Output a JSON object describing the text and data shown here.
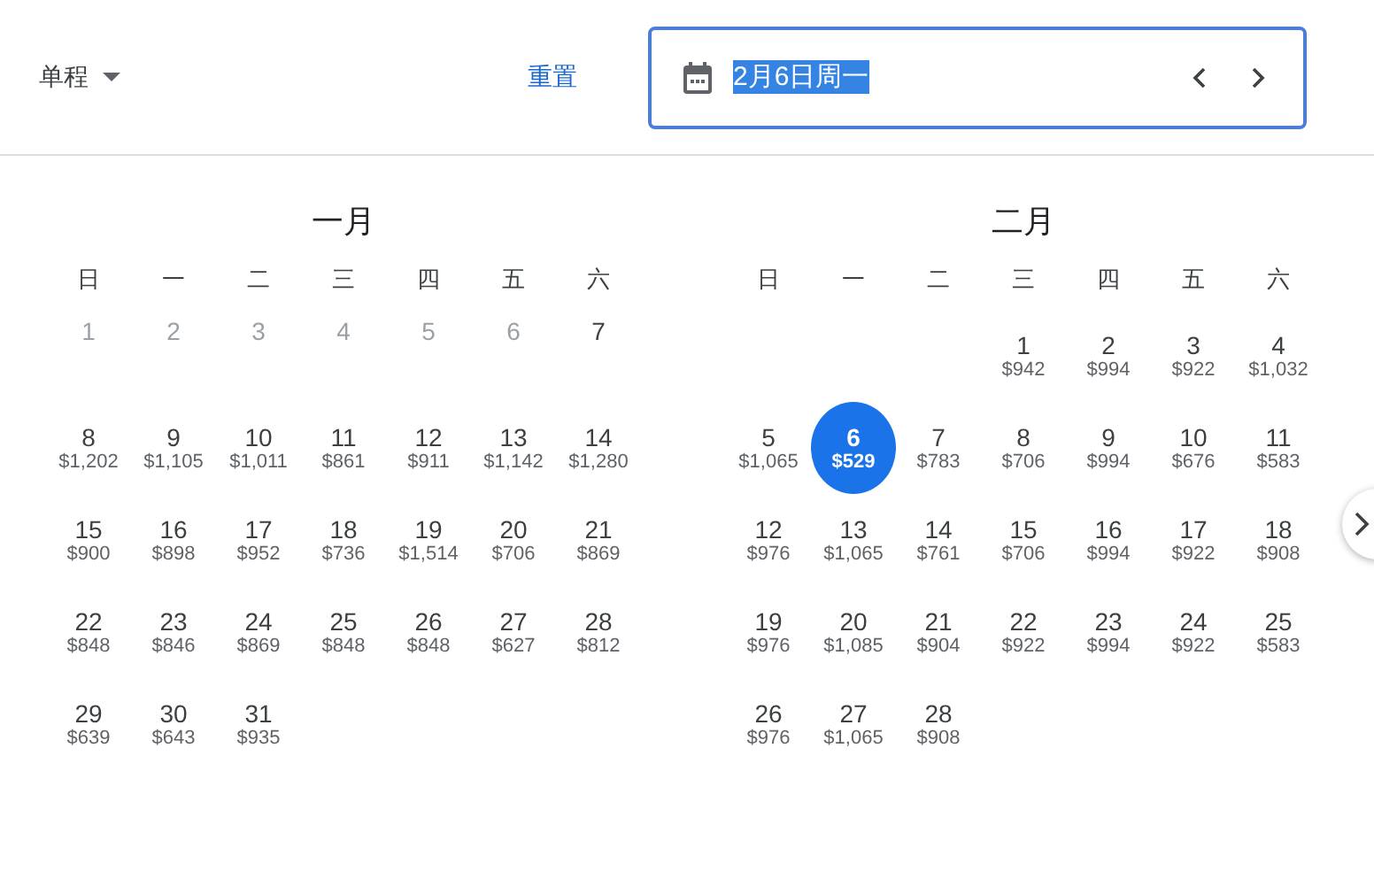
{
  "trip_type": {
    "label": "单程"
  },
  "reset_link": "重置",
  "date_field": {
    "value": "2月6日周一",
    "value_highlighted": true
  },
  "months": [
    {
      "title": "一月",
      "weekdays": [
        "日",
        "一",
        "二",
        "三",
        "四",
        "五",
        "六"
      ],
      "weeks": [
        {
          "sun": {
            "day": "1",
            "disabled": true,
            "selected": false
          },
          "mon": {
            "day": "2",
            "disabled": true,
            "selected": false
          },
          "tue": {
            "day": "3",
            "disabled": true,
            "selected": false
          },
          "wed": {
            "day": "4",
            "disabled": true,
            "selected": false
          },
          "thu": {
            "day": "5",
            "disabled": true,
            "selected": false
          },
          "fri": {
            "day": "6",
            "disabled": true,
            "selected": false
          },
          "sat": {
            "day": "7",
            "disabled": false,
            "selected": false
          }
        },
        {
          "sun": {
            "day": "8",
            "price": "$1,202",
            "disabled": false,
            "selected": false
          },
          "mon": {
            "day": "9",
            "price": "$1,105",
            "disabled": false,
            "selected": false
          },
          "tue": {
            "day": "10",
            "price": "$1,011",
            "disabled": false,
            "selected": false
          },
          "wed": {
            "day": "11",
            "price": "$861",
            "disabled": false,
            "selected": false
          },
          "thu": {
            "day": "12",
            "price": "$911",
            "disabled": false,
            "selected": false
          },
          "fri": {
            "day": "13",
            "price": "$1,142",
            "disabled": false,
            "selected": false
          },
          "sat": {
            "day": "14",
            "price": "$1,280",
            "disabled": false,
            "selected": false
          }
        },
        {
          "sun": {
            "day": "15",
            "price": "$900",
            "disabled": false,
            "selected": false
          },
          "mon": {
            "day": "16",
            "price": "$898",
            "disabled": false,
            "selected": false
          },
          "tue": {
            "day": "17",
            "price": "$952",
            "disabled": false,
            "selected": false
          },
          "wed": {
            "day": "18",
            "price": "$736",
            "disabled": false,
            "selected": false
          },
          "thu": {
            "day": "19",
            "price": "$1,514",
            "disabled": false,
            "selected": false
          },
          "fri": {
            "day": "20",
            "price": "$706",
            "disabled": false,
            "selected": false
          },
          "sat": {
            "day": "21",
            "price": "$869",
            "disabled": false,
            "selected": false
          }
        },
        {
          "sun": {
            "day": "22",
            "price": "$848",
            "disabled": false,
            "selected": false
          },
          "mon": {
            "day": "23",
            "price": "$846",
            "disabled": false,
            "selected": false
          },
          "tue": {
            "day": "24",
            "price": "$869",
            "disabled": false,
            "selected": false
          },
          "wed": {
            "day": "25",
            "price": "$848",
            "disabled": false,
            "selected": false
          },
          "thu": {
            "day": "26",
            "price": "$848",
            "disabled": false,
            "selected": false
          },
          "fri": {
            "day": "27",
            "price": "$627",
            "disabled": false,
            "selected": false
          },
          "sat": {
            "day": "28",
            "price": "$812",
            "disabled": false,
            "selected": false
          }
        },
        {
          "sun": {
            "day": "29",
            "price": "$639",
            "disabled": false,
            "selected": false
          },
          "mon": {
            "day": "30",
            "price": "$643",
            "disabled": false,
            "selected": false
          },
          "tue": {
            "day": "31",
            "price": "$935",
            "disabled": false,
            "selected": false
          }
        }
      ]
    },
    {
      "title": "二月",
      "weekdays": [
        "日",
        "一",
        "二",
        "三",
        "四",
        "五",
        "六"
      ],
      "weeks": [
        {
          "wed": {
            "day": "1",
            "price": "$942",
            "disabled": false,
            "selected": false
          },
          "thu": {
            "day": "2",
            "price": "$994",
            "disabled": false,
            "selected": false
          },
          "fri": {
            "day": "3",
            "price": "$922",
            "disabled": false,
            "selected": false
          },
          "sat": {
            "day": "4",
            "price": "$1,032",
            "disabled": false,
            "selected": false
          }
        },
        {
          "sun": {
            "day": "5",
            "price": "$1,065",
            "disabled": false,
            "selected": false
          },
          "mon": {
            "day": "6",
            "price": "$529",
            "disabled": false,
            "selected": true
          },
          "tue": {
            "day": "7",
            "price": "$783",
            "disabled": false,
            "selected": false
          },
          "wed": {
            "day": "8",
            "price": "$706",
            "disabled": false,
            "selected": false
          },
          "thu": {
            "day": "9",
            "price": "$994",
            "disabled": false,
            "selected": false
          },
          "fri": {
            "day": "10",
            "price": "$676",
            "disabled": false,
            "selected": false
          },
          "sat": {
            "day": "11",
            "price": "$583",
            "disabled": false,
            "selected": false
          }
        },
        {
          "sun": {
            "day": "12",
            "price": "$976",
            "disabled": false,
            "selected": false
          },
          "mon": {
            "day": "13",
            "price": "$1,065",
            "disabled": false,
            "selected": false
          },
          "tue": {
            "day": "14",
            "price": "$761",
            "disabled": false,
            "selected": false
          },
          "wed": {
            "day": "15",
            "price": "$706",
            "disabled": false,
            "selected": false
          },
          "thu": {
            "day": "16",
            "price": "$994",
            "disabled": false,
            "selected": false
          },
          "fri": {
            "day": "17",
            "price": "$922",
            "disabled": false,
            "selected": false
          },
          "sat": {
            "day": "18",
            "price": "$908",
            "disabled": false,
            "selected": false
          }
        },
        {
          "sun": {
            "day": "19",
            "price": "$976",
            "disabled": false,
            "selected": false
          },
          "mon": {
            "day": "20",
            "price": "$1,085",
            "disabled": false,
            "selected": false
          },
          "tue": {
            "day": "21",
            "price": "$904",
            "disabled": false,
            "selected": false
          },
          "wed": {
            "day": "22",
            "price": "$922",
            "disabled": false,
            "selected": false
          },
          "thu": {
            "day": "23",
            "price": "$994",
            "disabled": false,
            "selected": false
          },
          "fri": {
            "day": "24",
            "price": "$922",
            "disabled": false,
            "selected": false
          },
          "sat": {
            "day": "25",
            "price": "$583",
            "disabled": false,
            "selected": false
          }
        },
        {
          "sun": {
            "day": "26",
            "price": "$976",
            "disabled": false,
            "selected": false
          },
          "mon": {
            "day": "27",
            "price": "$1,065",
            "disabled": false,
            "selected": false
          },
          "tue": {
            "day": "28",
            "price": "$908",
            "disabled": false,
            "selected": false
          }
        }
      ]
    }
  ]
}
